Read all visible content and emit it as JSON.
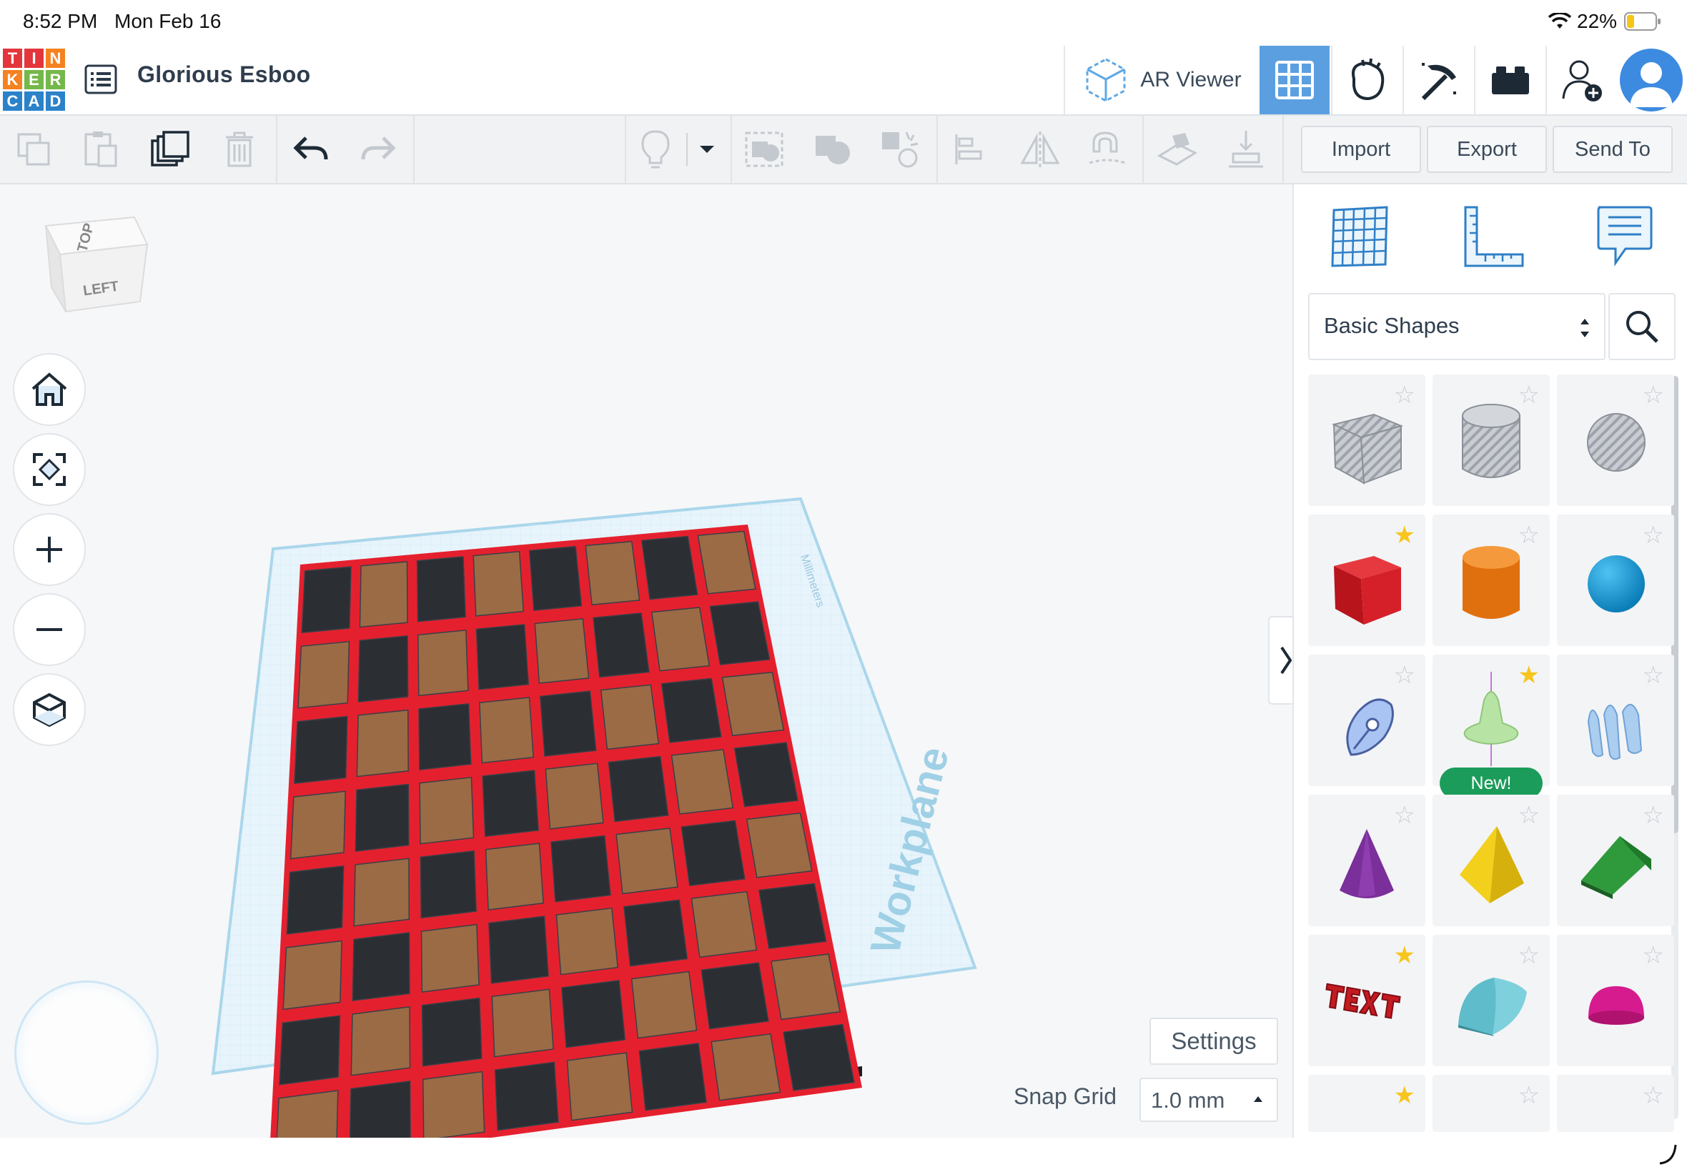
{
  "status_bar": {
    "time": "8:52 PM",
    "date": "Mon Feb 16",
    "battery": "22%"
  },
  "header": {
    "logo_letters": [
      "T",
      "I",
      "N",
      "K",
      "E",
      "R",
      "C",
      "A",
      "D"
    ],
    "title": "Glorious Esboo",
    "ar_viewer_label": "AR Viewer"
  },
  "toolbar": {
    "import_label": "Import",
    "export_label": "Export",
    "send_to_label": "Send To"
  },
  "view_cube": {
    "top_label": "TOP",
    "left_label": "LEFT"
  },
  "workplane": {
    "label": "Workplane",
    "small_label": "Millimeters"
  },
  "canvas": {
    "settings_label": "Settings",
    "snap_grid_label": "Snap Grid",
    "snap_grid_value": "1.0 mm"
  },
  "panel": {
    "category": "Basic Shapes",
    "new_badge": "New!",
    "shapes": [
      {
        "name": "box-hole-icon",
        "starred": false
      },
      {
        "name": "cylinder-hole-icon",
        "starred": false
      },
      {
        "name": "sphere-hole-icon",
        "starred": false
      },
      {
        "name": "box-icon",
        "starred": true
      },
      {
        "name": "cylinder-icon",
        "starred": false
      },
      {
        "name": "sphere-icon",
        "starred": false
      },
      {
        "name": "scribble-icon",
        "starred": false
      },
      {
        "name": "spinning-top-icon",
        "starred": true
      },
      {
        "name": "shape-generator-icon",
        "starred": false
      },
      {
        "name": "cone-icon",
        "starred": false
      },
      {
        "name": "pyramid-icon",
        "starred": false
      },
      {
        "name": "roof-icon",
        "starred": false
      },
      {
        "name": "text-icon",
        "starred": true
      },
      {
        "name": "half-cylinder-icon",
        "starred": false
      },
      {
        "name": "half-sphere-icon",
        "starred": false
      }
    ]
  },
  "colors": {
    "accent": "#4a90d9",
    "board_dark": "#2b2e33",
    "board_light": "#9b6b45",
    "board_line": "#e5202e"
  }
}
